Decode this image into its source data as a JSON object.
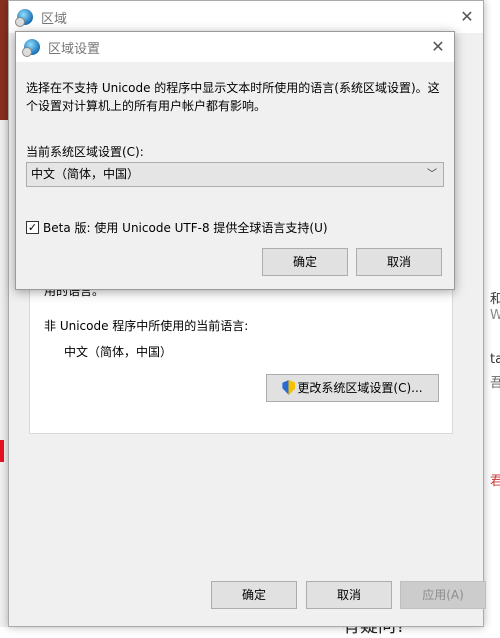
{
  "outer": {
    "title": "区域",
    "panel_partial_text": "用的语言。",
    "current_lang_label": "非 Unicode 程序中所使用的当前语言:",
    "current_lang_value": "中文（简体，中国）",
    "change_button": "更改系统区域设置(C)...",
    "ok": "确定",
    "cancel": "取消",
    "apply": "应用(A)"
  },
  "dialog": {
    "title": "区域设置",
    "description": "选择在不支持 Unicode 的程序中显示文本时所使用的语言(系统区域设置)。这个设置对计算机上的所有用户帐户都有影响。",
    "locale_label": "当前系统区域设置(C):",
    "locale_value": "中文（简体，中国）",
    "beta_checked": true,
    "beta_label": "Beta 版: 使用 Unicode UTF-8 提供全球语言支持(U)",
    "ok": "确定",
    "cancel": "取消"
  },
  "background": {
    "right_fragments": [
      "和",
      "W",
      "ta",
      "吾",
      "君"
    ],
    "bottom_fragment": "有疑问?"
  }
}
